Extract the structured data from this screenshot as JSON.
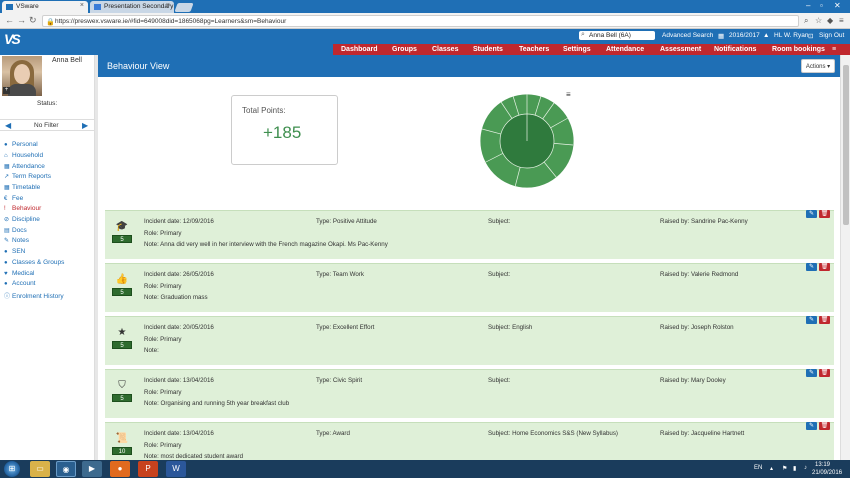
{
  "browser": {
    "tabs": [
      {
        "label": "VSware",
        "active": true
      },
      {
        "label": "Presentation Secondary",
        "active": false
      }
    ],
    "url": "https://preswex.vsware.ie/#fid=649008did=1865068pg=Learners&sm=Behaviour"
  },
  "header": {
    "logo": "VS",
    "search_value": "Anna Bell (6A)",
    "advanced_search": "Advanced Search",
    "year": "2016/2017",
    "user": "HL W. Ryan",
    "sign_out": "Sign Out"
  },
  "nav": [
    "Dashboard",
    "Groups",
    "Classes",
    "Students",
    "Teachers",
    "Settings",
    "Attendance",
    "Assessment",
    "Notifications",
    "Room bookings"
  ],
  "sidebar": {
    "student_name": "Anna Bell",
    "status_label": "Status:",
    "filter_label": "No Filter",
    "items": [
      {
        "label": "Personal",
        "icon": "user-icon",
        "active": false
      },
      {
        "label": "Household",
        "icon": "home-icon",
        "active": false
      },
      {
        "label": "Attendance",
        "icon": "calendar-icon",
        "active": false
      },
      {
        "label": "Term Reports",
        "icon": "chart-line-icon",
        "active": false
      },
      {
        "label": "Timetable",
        "icon": "calendar-icon",
        "active": false
      },
      {
        "label": "Fee",
        "icon": "euro-icon",
        "active": false
      },
      {
        "label": "Behaviour",
        "icon": "exclamation-icon",
        "active": true
      },
      {
        "label": "Discipline",
        "icon": "ban-icon",
        "active": false
      },
      {
        "label": "Docs",
        "icon": "file-icon",
        "active": false
      },
      {
        "label": "Notes",
        "icon": "pencil-icon",
        "active": false
      },
      {
        "label": "SEN",
        "icon": "users-icon",
        "active": false
      },
      {
        "label": "Classes & Groups",
        "icon": "users-icon",
        "active": false
      },
      {
        "label": "Medical",
        "icon": "heart-icon",
        "active": false
      },
      {
        "label": "Account",
        "icon": "user-icon",
        "active": false
      },
      {
        "label": "Enrolment History",
        "icon": "info-icon",
        "active": false
      }
    ]
  },
  "main": {
    "title": "Behaviour View",
    "actions_label": "Actions",
    "total_points_label": "Total Points:",
    "total_points_value": "+185"
  },
  "records": [
    {
      "incident_date": "Incident date: 12/09/2016",
      "type": "Type: Positive Attitude",
      "subject": "Subject:",
      "raised_by": "Raised by: Sandrine Pac-Kenny",
      "role": "Role: Primary",
      "note": "Note: Anna did very well in her interview with the French magazine Okapi. Ms Pac-Kenny",
      "points": "5",
      "icon": "graduation-cap-icon"
    },
    {
      "incident_date": "Incident date: 26/05/2016",
      "type": "Type: Team Work",
      "subject": "Subject:",
      "raised_by": "Raised by: Valerie Redmond",
      "role": "Role: Primary",
      "note": "Note: Graduation mass",
      "points": "5",
      "icon": "thumbs-up-icon"
    },
    {
      "incident_date": "Incident date: 20/05/2016",
      "type": "Type: Excellent Effort",
      "subject": "Subject: English",
      "raised_by": "Raised by: Joseph Rolston",
      "role": "Role: Primary",
      "note": "Note:",
      "points": "5",
      "icon": "star-icon"
    },
    {
      "incident_date": "Incident date: 13/04/2016",
      "type": "Type: Civic Spirit",
      "subject": "Subject:",
      "raised_by": "Raised by: Mary Dooley",
      "role": "Role: Primary",
      "note": "Note: Organising and running 5th year breakfast club",
      "points": "5",
      "icon": "shield-icon"
    },
    {
      "incident_date": "Incident date: 13/04/2016",
      "type": "Type: Award",
      "subject": "Subject: Home Economics S&S (New Syllabus)",
      "raised_by": "Raised by: Jacqueline Hartnett",
      "role": "Role: Primary",
      "note": "Note: most dedicated student award",
      "points": "10",
      "icon": "certificate-icon"
    }
  ],
  "taskbar": {
    "lang": "EN",
    "time": "13:19",
    "date": "21/09/2016"
  },
  "colors": {
    "brand_blue": "#1f6fb5",
    "nav_red": "#c0282e",
    "card_green": "#dff0d8",
    "pie_green": "#4a9a54"
  }
}
